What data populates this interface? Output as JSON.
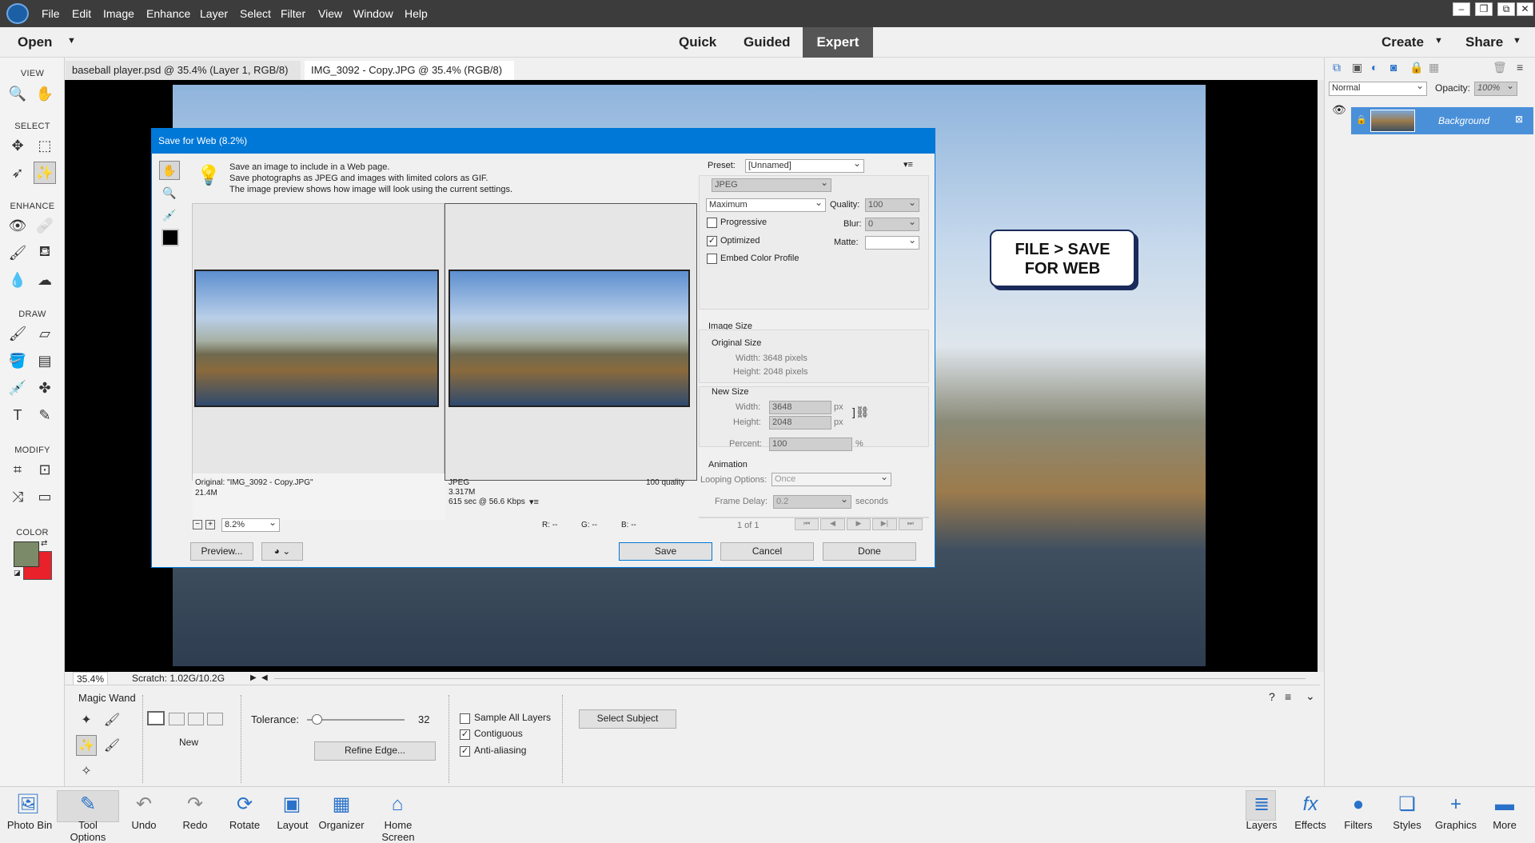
{
  "menubar": {
    "items": [
      "File",
      "Edit",
      "Image",
      "Enhance",
      "Layer",
      "Select",
      "Filter",
      "View",
      "Window",
      "Help"
    ]
  },
  "modebar": {
    "open": "Open",
    "modes": [
      "Quick",
      "Guided",
      "Expert"
    ],
    "active": "Expert",
    "create": "Create",
    "share": "Share"
  },
  "toolbox": {
    "sections": [
      "VIEW",
      "SELECT",
      "ENHANCE",
      "DRAW",
      "MODIFY",
      "COLOR"
    ],
    "fg_color": "#7b8a68",
    "bg_color": "#e8212a"
  },
  "tabs": [
    {
      "label": "baseball player.psd @ 35.4% (Layer 1, RGB/8)",
      "close": "×"
    },
    {
      "label": "IMG_3092 - Copy.JPG @ 35.4% (RGB/8)",
      "close": "×"
    }
  ],
  "callout": {
    "line1": "FILE > SAVE",
    "line2": "FOR WEB"
  },
  "status": {
    "zoom": "35.4%",
    "scratch": "Scratch: 1.02G/10.2G"
  },
  "options": {
    "tool_name": "Magic Wand",
    "mode_label": "New",
    "tolerance_label": "Tolerance:",
    "tolerance_value": "32",
    "tolerance_fraction": 0.05,
    "refine": "Refine Edge...",
    "sample_all": "Sample All Layers",
    "contiguous": "Contiguous",
    "antialias": "Anti-aliasing",
    "select_subject": "Select Subject"
  },
  "layers": {
    "blend": "Normal",
    "opacity_label": "Opacity:",
    "opacity": "100%",
    "layer_name": "Background"
  },
  "taskbar": {
    "left": [
      "Photo Bin",
      "Tool Options",
      "Undo",
      "Redo",
      "Rotate",
      "Layout",
      "Organizer",
      "Home Screen"
    ],
    "right": [
      "Layers",
      "Effects",
      "Filters",
      "Styles",
      "Graphics",
      "More"
    ]
  },
  "dialog": {
    "title": "Save for Web (8.2%)",
    "info": [
      "Save an image to include in a Web page.",
      "Save photographs as JPEG and images with limited colors as GIF.",
      "The image preview shows how image will look using the current settings."
    ],
    "original_caption": "Original: \"IMG_3092 - Copy.JPG\"",
    "original_size": "21.4M",
    "jpeg_caption": "JPEG",
    "jpeg_size": "3.317M",
    "jpeg_time": "615 sec @ 56.6 Kbps",
    "jpeg_quality": "100 quality",
    "zoom": "8.2%",
    "r": "R: --",
    "g": "G: --",
    "b": "B: --",
    "preview_btn": "Preview...",
    "save": "Save",
    "cancel": "Cancel",
    "done": "Done",
    "preset_label": "Preset:",
    "preset": "[Unnamed]",
    "format": "JPEG",
    "compression": "Maximum",
    "quality_label": "Quality:",
    "quality": "100",
    "blur_label": "Blur:",
    "blur": "0",
    "matte_label": "Matte:",
    "progressive": "Progressive",
    "optimized": "Optimized",
    "embed": "Embed Color Profile",
    "image_size": "Image Size",
    "original_size_label": "Original Size",
    "orig_width": "Width:  3648 pixels",
    "orig_height": "Height:  2048 pixels",
    "new_size": "New Size",
    "width_label": "Width:",
    "width": "3648",
    "height_label": "Height:",
    "height": "2048",
    "px": "px",
    "percent_label": "Percent:",
    "percent": "100",
    "pct": "%",
    "animation": "Animation",
    "looping_label": "Looping Options:",
    "looping": "Once",
    "frame_delay_label": "Frame Delay:",
    "frame_delay": "0.2",
    "seconds": "seconds",
    "frame_counter": "1 of 1"
  }
}
